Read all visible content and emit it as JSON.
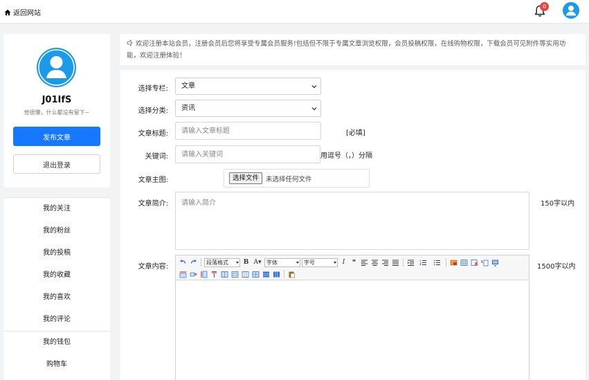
{
  "topbar": {
    "back_label": "返回网站",
    "notification_count": "0"
  },
  "user": {
    "name": "J01IfS",
    "signature": "他很懒，什么都没有留下~",
    "publish_label": "发布文章",
    "logout_label": "退出登录"
  },
  "menu": {
    "items": [
      {
        "label": "我的关注"
      },
      {
        "label": "我的粉丝"
      },
      {
        "label": "我的投稿"
      },
      {
        "label": "我的收藏"
      },
      {
        "label": "我的喜欢"
      },
      {
        "label": "我的评论"
      },
      {
        "label": "我的钱包"
      },
      {
        "label": "购物车"
      }
    ]
  },
  "notice": {
    "text": "欢迎注册本站会员，注册会员后您将享受专属会员服务!包括但不限于专属文章浏览权限，会员投稿权限，在线购物权限，下载会员可见附件等实用功能，欢迎注册体验！"
  },
  "form": {
    "column_label": "选择专栏:",
    "column_value": "文章",
    "category_label": "选择分类:",
    "category_value": "资讯",
    "title_label": "文章标题:",
    "title_placeholder": "请输入文章标题",
    "title_required": "[必填]",
    "keywords_label": "关键词:",
    "keywords_placeholder": "请输入关键词",
    "keywords_hint": "用逗号（，）分隔",
    "image_label": "文章主图:",
    "file_button": "选择文件",
    "file_status": "未选择任何文件",
    "summary_label": "文章简介:",
    "summary_placeholder": "请输入简介",
    "summary_limit": "150字以内",
    "content_label": "文章内容:",
    "content_limit": "1500字以内"
  },
  "editor": {
    "paragraph_label": "段落格式",
    "font_label": "字体",
    "size_label": "字号"
  },
  "colors": {
    "primary": "#1677ff",
    "badge": "#e9423c",
    "avatar": "#1a9ae8"
  }
}
